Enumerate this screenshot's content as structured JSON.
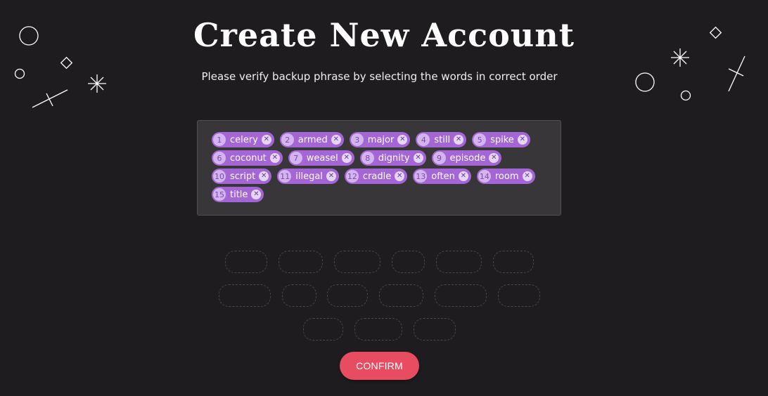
{
  "header": {
    "title": "Create New Account",
    "subtitle": "Please verify backup phrase by selecting the words in correct order"
  },
  "selected_words": [
    {
      "number": "1",
      "word": "celery"
    },
    {
      "number": "2",
      "word": "armed"
    },
    {
      "number": "3",
      "word": "major"
    },
    {
      "number": "4",
      "word": "still"
    },
    {
      "number": "5",
      "word": "spike"
    },
    {
      "number": "6",
      "word": "coconut"
    },
    {
      "number": "7",
      "word": "weasel"
    },
    {
      "number": "8",
      "word": "dignity"
    },
    {
      "number": "9",
      "word": "episode"
    },
    {
      "number": "10",
      "word": "script"
    },
    {
      "number": "11",
      "word": "illegal"
    },
    {
      "number": "12",
      "word": "cradle"
    },
    {
      "number": "13",
      "word": "often"
    },
    {
      "number": "14",
      "word": "room"
    },
    {
      "number": "15",
      "word": "title"
    }
  ],
  "remove_icon": "x-circle-icon",
  "empty_slots_count": 15,
  "actions": {
    "confirm_label": "CONFIRM"
  },
  "colors": {
    "background": "#1f1c20",
    "chip": "#a466d4",
    "chip_number": "#d3b4ef",
    "confirm": "#e84c61",
    "phrase_box": "#39363a"
  }
}
